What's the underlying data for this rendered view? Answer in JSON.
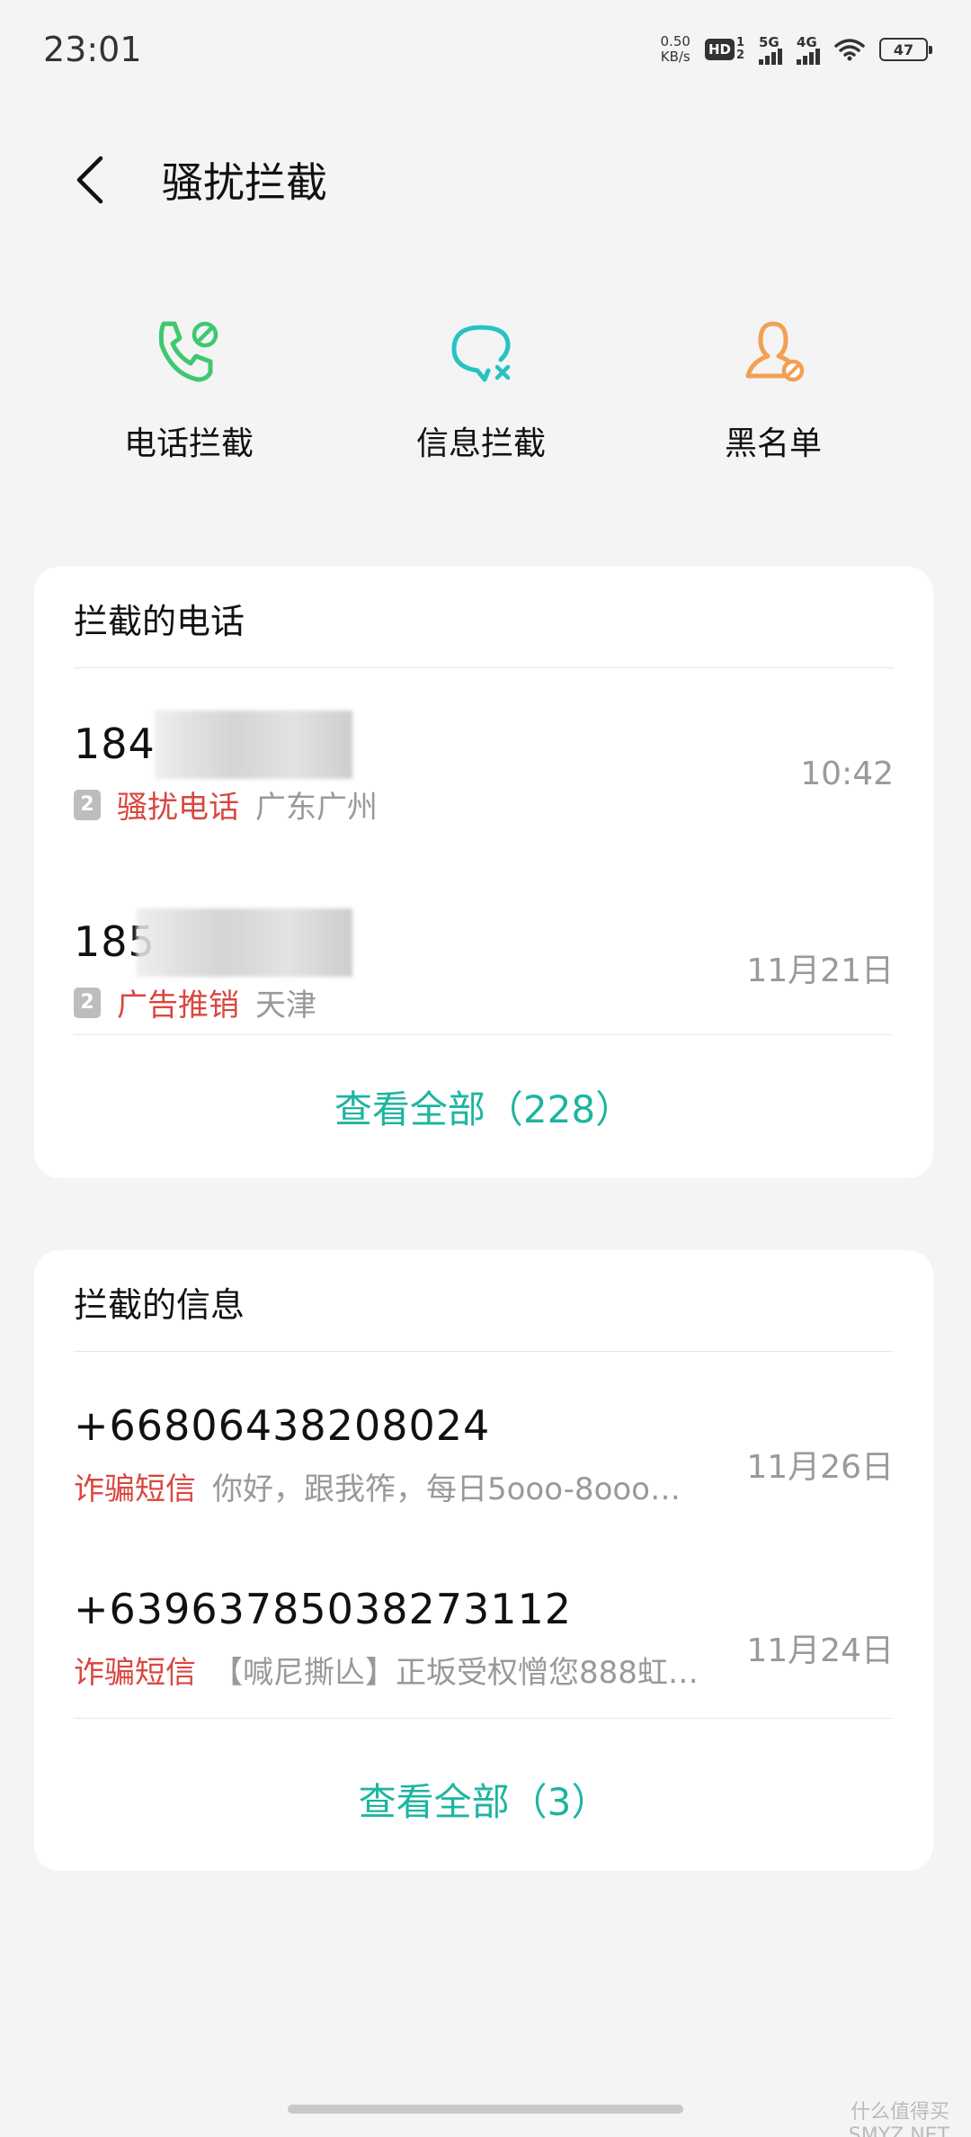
{
  "status_bar": {
    "time": "23:01",
    "net_speed_value": "0.50",
    "net_speed_unit": "KB/s",
    "hd_label": "HD",
    "sim_top": "1",
    "sim_bottom": "2",
    "signal1_gen": "5G",
    "signal2_gen": "4G",
    "battery": "47"
  },
  "header": {
    "title": "骚扰拦截"
  },
  "quick_actions": [
    {
      "label": "电话拦截",
      "icon": "phone-block-icon",
      "color": "#3fc86f"
    },
    {
      "label": "信息拦截",
      "icon": "message-block-icon",
      "color": "#27c3c3"
    },
    {
      "label": "黑名单",
      "icon": "blacklist-person-icon",
      "color": "#f2a052"
    }
  ],
  "calls_card": {
    "title": "拦截的电话",
    "rows": [
      {
        "number": "184",
        "sim": "2",
        "tag": "骚扰电话",
        "location": "广东广州",
        "time": "10:42"
      },
      {
        "number": "185",
        "sim": "2",
        "tag": "广告推销",
        "location": "天津",
        "time": "11月21日"
      }
    ],
    "view_all": "查看全部（228）"
  },
  "msgs_card": {
    "title": "拦截的信息",
    "rows": [
      {
        "number": "+66806438208024",
        "tag": "诈骗短信",
        "preview": "你好，跟我筰，每日5ooo-8ooo…",
        "time": "11月26日"
      },
      {
        "number": "+63963785038273112",
        "tag": "诈骗短信",
        "preview": "【喊尼撕亾】正坂受权憎您888虹…",
        "time": "11月24日"
      }
    ],
    "view_all": "查看全部（3）"
  },
  "watermark": {
    "line1": "什么值得买",
    "line2": "SMYZ.NET"
  }
}
